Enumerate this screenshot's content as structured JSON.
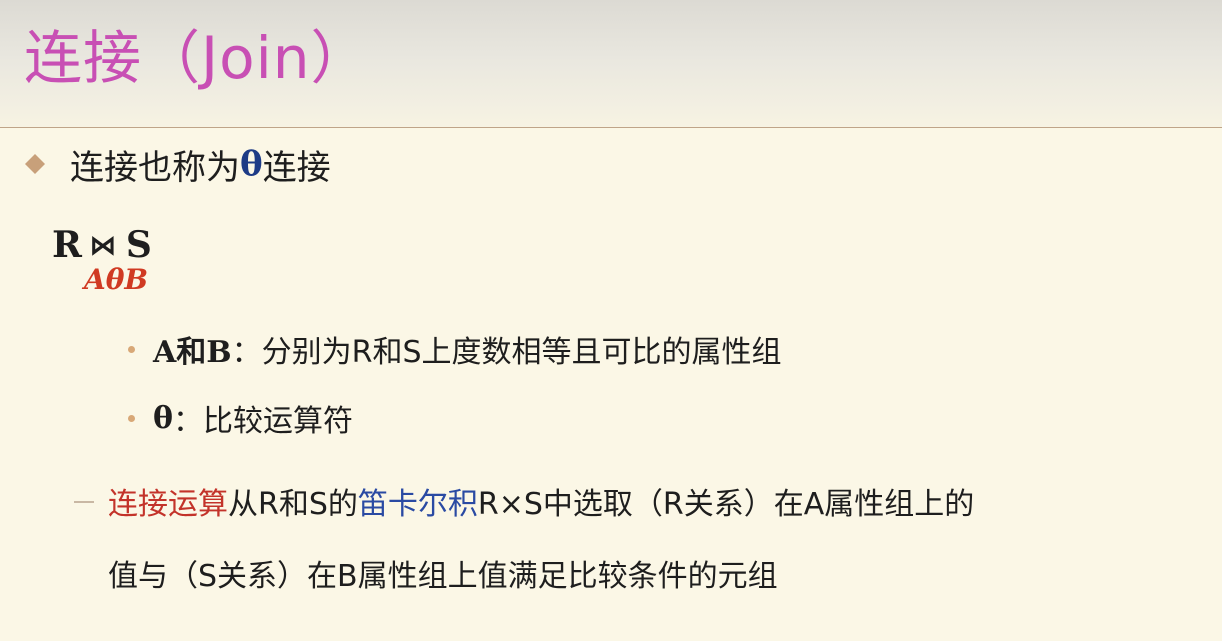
{
  "title": "连接（Join）",
  "bullet": {
    "prefix": "连接也称为",
    "theta": "θ",
    "suffix": "连接"
  },
  "formula": {
    "left": "R",
    "operator": "⋈",
    "right": "S",
    "condition": "AθB"
  },
  "sub_items": [
    {
      "term": "A和B",
      "text": "：分别为R和S上度数相等且可比的属性组"
    },
    {
      "term": "θ",
      "text": "：比较运算符"
    }
  ],
  "paragraph": {
    "red_part": "连接运算",
    "part2": "从R和S的",
    "blue_part": "笛卡尔积",
    "part3": "R×S中选取（R关系）在A属性组上的",
    "line2": "值与（S关系）在B属性组上值满足比较条件的元组"
  },
  "colors": {
    "title": "#c84fb4",
    "bullet_marker": "#c8a07a",
    "theta": "#1d3b86",
    "condition": "#d03a22",
    "highlight_red": "#c3332a",
    "highlight_blue": "#2a4aa3"
  }
}
